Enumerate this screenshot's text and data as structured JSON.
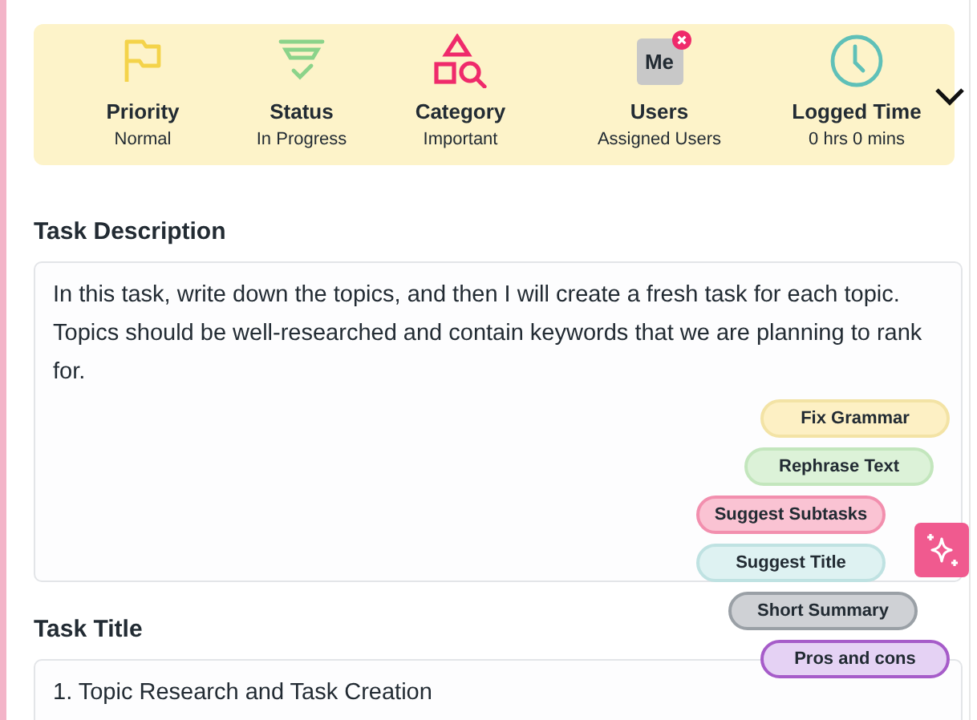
{
  "summary_bar": {
    "items": [
      {
        "kind": "flag",
        "label": "Priority",
        "value": "Normal"
      },
      {
        "kind": "status",
        "label": "Status",
        "value": "In Progress"
      },
      {
        "kind": "category",
        "label": "Category",
        "value": "Important"
      },
      {
        "kind": "avatar",
        "avatar_text": "Me",
        "label": "Users",
        "value": "Assigned Users"
      },
      {
        "kind": "clock",
        "label": "Logged Time",
        "value": "0 hrs 0 mins"
      }
    ],
    "expanded": false
  },
  "description": {
    "label": "Task Description",
    "value": "In this task, write down the topics, and then I will create a fresh task for each topic. Topics should be well-researched and contain keywords that we are planning to rank for."
  },
  "title": {
    "label": "Task Title",
    "value": "1. Topic Research and Task Creation"
  },
  "ai_menu": {
    "expanded": true,
    "actions": [
      {
        "label": "Fix Grammar",
        "color": "#fdf0c4"
      },
      {
        "label": "Rephrase Text",
        "color": "#dcf2d8"
      },
      {
        "label": "Suggest Subtasks",
        "color": "#fac3d3"
      },
      {
        "label": "Suggest Title",
        "color": "#def2f2"
      },
      {
        "label": "Short Summary",
        "color": "#cfd1d5"
      },
      {
        "label": "Pros and cons",
        "color": "#e5d2f4"
      }
    ]
  }
}
